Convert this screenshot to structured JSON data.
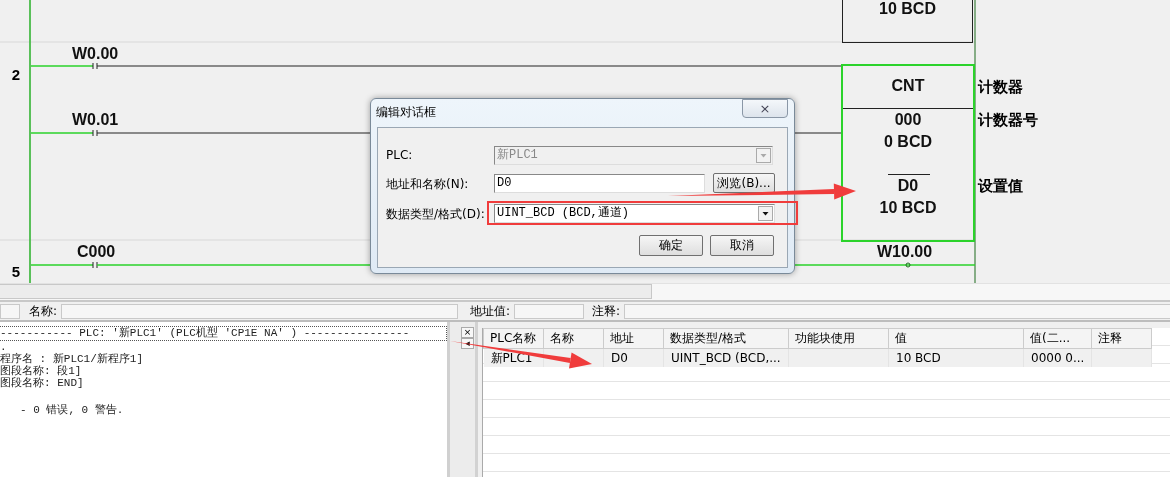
{
  "ladder": {
    "rung_numbers": [
      "2",
      "5"
    ],
    "contacts": [
      "W0.00",
      "W0.01",
      "C000"
    ],
    "top_block_text": "10 BCD",
    "cnt_block": {
      "title": "CNT",
      "operands": [
        "000",
        "0 BCD"
      ],
      "setting": [
        "D0",
        "10 BCD"
      ]
    },
    "operand_comments": [
      "计数器",
      "计数器号",
      "设置值"
    ],
    "output_label": "W10.00"
  },
  "dialog": {
    "title": "编辑对话框",
    "close": "×",
    "fields": [
      {
        "kind": "combo",
        "label": "PLC:",
        "value": "新PLC1",
        "disabled": true,
        "highlighted": false
      },
      {
        "kind": "text",
        "label": "地址和名称(N):",
        "value": "D0",
        "disabled": false,
        "highlighted": false
      },
      {
        "kind": "combo",
        "label": "数据类型/格式(D):",
        "value": "UINT_BCD (BCD,通道)",
        "disabled": false,
        "highlighted": true
      }
    ],
    "browse_button": "浏览(B)...",
    "buttons": [
      "确定",
      "取消"
    ]
  },
  "properties_bar": [
    {
      "label": "名称:"
    },
    {
      "label": "地址值:"
    },
    {
      "label": "注释:"
    }
  ],
  "output_panel": {
    "header": "----------- PLC: '新PLC1' (PLC机型 'CP1E NA' ) ----------------",
    "lines": [
      ".",
      "程序名 : 新PLC1/新程序1]",
      "图段名称: 段1]",
      "图段名称: END]"
    ],
    "summary": "- 0 错误, 0 警告."
  },
  "splitter_buttons": [
    "×",
    "◂"
  ],
  "watch_table": {
    "columns": [
      "PLC名称",
      "名称",
      "地址",
      "数据类型/格式",
      "功能块使用",
      "值",
      "值(二...",
      "注释"
    ],
    "rows": [
      {
        "cells": {
          "0": "新PLC1",
          "2": "D0",
          "3": "UINT_BCD (BCD,...",
          "5": "10 BCD",
          "6": "0000 0..."
        },
        "selected": true
      }
    ]
  }
}
